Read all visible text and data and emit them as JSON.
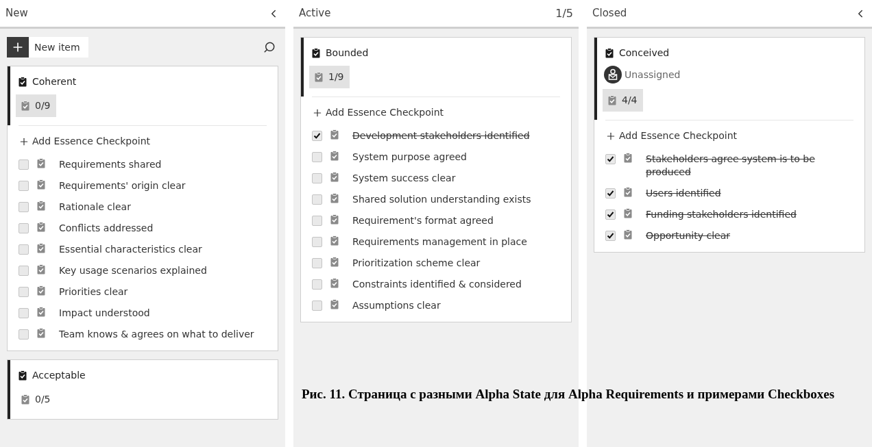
{
  "columns": [
    {
      "title": "New",
      "collapsible": true,
      "toolbar": {
        "new_item_label": "New item"
      },
      "cards": [
        {
          "title": "Coherent",
          "progress": "0/9",
          "progress_highlighted": true,
          "add_label": "Add Essence Checkpoint",
          "checkpoints": [
            {
              "label": "Requirements shared",
              "checked": false
            },
            {
              "label": "Requirements' origin clear",
              "checked": false
            },
            {
              "label": "Rationale clear",
              "checked": false
            },
            {
              "label": "Conflicts addressed",
              "checked": false
            },
            {
              "label": "Essential characteristics clear",
              "checked": false
            },
            {
              "label": "Key usage scenarios explained",
              "checked": false
            },
            {
              "label": "Priorities clear",
              "checked": false
            },
            {
              "label": "Impact understood",
              "checked": false
            },
            {
              "label": "Team knows & agrees on what to deliver",
              "checked": false
            }
          ]
        },
        {
          "title": "Acceptable",
          "progress": "0/5",
          "progress_highlighted": false
        }
      ]
    },
    {
      "title": "Active",
      "count": "1/5",
      "collapsible": false,
      "cards": [
        {
          "title": "Bounded",
          "progress": "1/9",
          "progress_highlighted": true,
          "add_label": "Add Essence Checkpoint",
          "checkpoints": [
            {
              "label": "Development stakeholders identified",
              "checked": true
            },
            {
              "label": "System purpose agreed",
              "checked": false
            },
            {
              "label": "System success clear",
              "checked": false
            },
            {
              "label": "Shared solution understanding exists",
              "checked": false
            },
            {
              "label": "Requirement's format agreed",
              "checked": false
            },
            {
              "label": "Requirements management in place",
              "checked": false
            },
            {
              "label": "Prioritization scheme clear",
              "checked": false
            },
            {
              "label": "Constraints identified & considered",
              "checked": false
            },
            {
              "label": "Assumptions clear",
              "checked": false
            }
          ]
        }
      ]
    },
    {
      "title": "Closed",
      "collapsible": true,
      "cards": [
        {
          "title": "Conceived",
          "assignee": "Unassigned",
          "progress": "4/4",
          "progress_highlighted": true,
          "add_label": "Add Essence Checkpoint",
          "checkpoints": [
            {
              "label": "Stakeholders agree system is to be produced",
              "checked": true
            },
            {
              "label": "Users identified",
              "checked": true
            },
            {
              "label": "Funding stakeholders identified",
              "checked": true
            },
            {
              "label": "Opportunity clear",
              "checked": true
            }
          ]
        }
      ]
    }
  ],
  "caption": "Рис. 11. Страница с разными Alpha State для Alpha Requirements и примерами Checkboxes"
}
